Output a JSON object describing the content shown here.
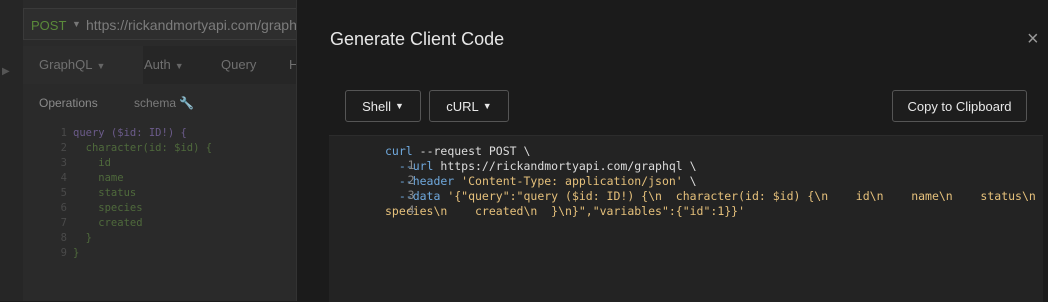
{
  "background": {
    "method": "POST",
    "url": "https://rickandmortyapi.com/graphql",
    "tabs": [
      "GraphQL",
      "Auth",
      "Query",
      "H"
    ],
    "subtabs": [
      "Operations",
      "schema"
    ],
    "code_lines": [
      {
        "num": "1",
        "text": "query ($id: ID!) {"
      },
      {
        "num": "2",
        "text": "  character(id: $id) {"
      },
      {
        "num": "3",
        "text": "    id"
      },
      {
        "num": "4",
        "text": "    name"
      },
      {
        "num": "5",
        "text": "    status"
      },
      {
        "num": "6",
        "text": "    species"
      },
      {
        "num": "7",
        "text": "    created"
      },
      {
        "num": "8",
        "text": "  }"
      },
      {
        "num": "9",
        "text": "}"
      }
    ]
  },
  "modal": {
    "title": "Generate Client Code",
    "close_symbol": "×",
    "language_button": "Shell",
    "client_button": "cURL",
    "copy_button": "Copy to Clipboard",
    "code": {
      "line1_num": "1",
      "line1_cmd": "curl",
      "line1_flag": "--request",
      "line1_rest": " POST \\",
      "line2_num": "2",
      "line2_flag": "  --url",
      "line2_rest": " https://rickandmortyapi.com/graphql \\",
      "line3_num": "3",
      "line3_flag": "  --header",
      "line3_str": " 'Content-Type: application/json'",
      "line3_rest": " \\",
      "line4_num": "4",
      "line4_flag": "  --data",
      "line4_str_a": " '{\"query\":\"query ($id: ID!) {\\n  character(id: $id) {\\n    id\\n    name\\n    status\\n",
      "line4_str_b": "species\\n    created\\n  }\\n}\",\"variables\":{\"id\":1}}'"
    }
  },
  "colors": {
    "modal_bg": "#1b1b1b",
    "code_bg": "#232323",
    "flag_blue": "#6fa8dc",
    "string_yellow": "#e5c07b"
  }
}
